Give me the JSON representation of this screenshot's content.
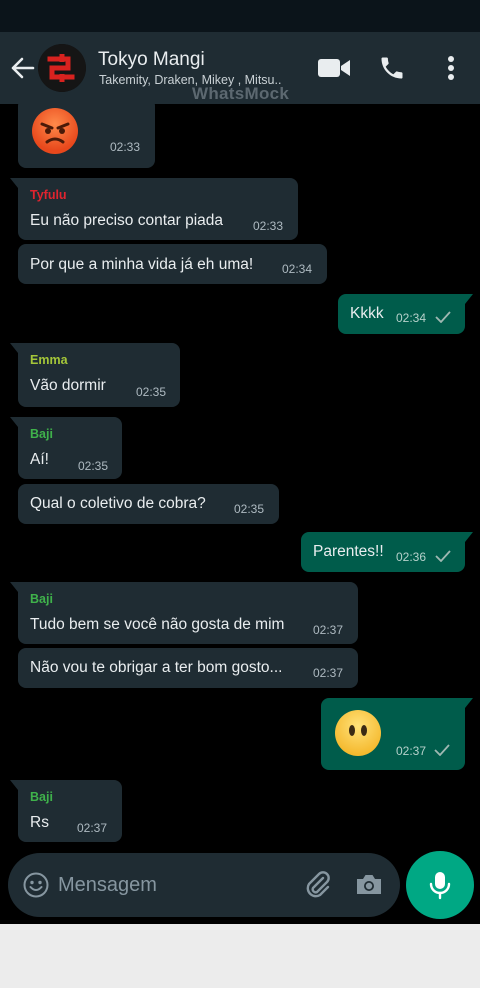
{
  "header": {
    "group_name": "Tokyo Mangi",
    "members": "Takemity, Draken, Mikey , Mitsu..",
    "watermark": "WhatsMock"
  },
  "colors": {
    "header_bg": "#1f2c33",
    "chat_bg": "#000000",
    "incoming_bubble": "#1f2c33",
    "outgoing_bubble": "#005c4b",
    "accent": "#00a884",
    "sender_tyfulu": "#e0242f",
    "sender_emma": "#a4c639",
    "sender_baji": "#3fb24b"
  },
  "messages": [
    {
      "direction": "in",
      "sender": "",
      "emoji": "angry-face",
      "text": "",
      "time": "02:33"
    },
    {
      "direction": "in",
      "sender": "Tyfulu",
      "text": "Eu não preciso contar piada",
      "time": "02:33"
    },
    {
      "direction": "in",
      "sender": "",
      "text": "Por que a minha vida já eh uma!",
      "time": "02:34"
    },
    {
      "direction": "out",
      "sender": "",
      "text": "Kkkk",
      "time": "02:34",
      "status": "sent-check"
    },
    {
      "direction": "in",
      "sender": "Emma",
      "text": "Vão dormir",
      "time": "02:35"
    },
    {
      "direction": "in",
      "sender": "Baji",
      "text": "Aí!",
      "time": "02:35"
    },
    {
      "direction": "in",
      "sender": "",
      "text": "Qual o coletivo de cobra?",
      "time": "02:35"
    },
    {
      "direction": "out",
      "sender": "",
      "text": "Parentes!!",
      "time": "02:36",
      "status": "sent-check"
    },
    {
      "direction": "in",
      "sender": "Baji",
      "text": "Tudo bem se você não gosta de mim",
      "time": "02:37"
    },
    {
      "direction": "in",
      "sender": "",
      "text": "Não vou te obrigar a ter bom gosto...",
      "time": "02:37"
    },
    {
      "direction": "out",
      "sender": "",
      "emoji": "face-without-mouth",
      "text": "",
      "time": "02:37",
      "status": "sent-check"
    },
    {
      "direction": "in",
      "sender": "Baji",
      "text": "Rs",
      "time": "02:37"
    }
  ],
  "composer": {
    "placeholder": "Mensagem"
  }
}
